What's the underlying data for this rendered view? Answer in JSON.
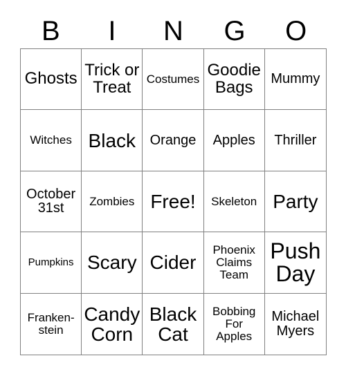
{
  "card": {
    "title_letters": [
      "B",
      "I",
      "N",
      "G",
      "O"
    ],
    "columns": 5,
    "rows": 5,
    "free_space_label": "Free!",
    "border_color": "#808080",
    "text_color": "#000000",
    "background_color": "#ffffff",
    "cells": [
      {
        "text": "Ghosts",
        "size": "lg"
      },
      {
        "text": "Trick or\nTreat",
        "size": "lg"
      },
      {
        "text": "Costumes",
        "size": "sm"
      },
      {
        "text": "Goodie\nBags",
        "size": "lg"
      },
      {
        "text": "Mummy",
        "size": "md"
      },
      {
        "text": "Witches",
        "size": "sm"
      },
      {
        "text": "Black",
        "size": "xl"
      },
      {
        "text": "Orange",
        "size": "md"
      },
      {
        "text": "Apples",
        "size": "md"
      },
      {
        "text": "Thriller",
        "size": "md"
      },
      {
        "text": "October\n31st",
        "size": "md"
      },
      {
        "text": "Zombies",
        "size": "sm"
      },
      {
        "text": "Free!",
        "size": "xl"
      },
      {
        "text": "Skeleton",
        "size": "sm"
      },
      {
        "text": "Party",
        "size": "xl"
      },
      {
        "text": "Pumpkins",
        "size": "xs"
      },
      {
        "text": "Scary",
        "size": "xl"
      },
      {
        "text": "Cider",
        "size": "xl"
      },
      {
        "text": "Phoenix\nClaims\nTeam",
        "size": "sm"
      },
      {
        "text": "Push\nDay",
        "size": "xxl"
      },
      {
        "text": "Franken-\nstein",
        "size": "sm"
      },
      {
        "text": "Candy\nCorn",
        "size": "xl"
      },
      {
        "text": "Black\nCat",
        "size": "xl"
      },
      {
        "text": "Bobbing\nFor\nApples",
        "size": "sm"
      },
      {
        "text": "Michael\nMyers",
        "size": "md"
      }
    ]
  }
}
